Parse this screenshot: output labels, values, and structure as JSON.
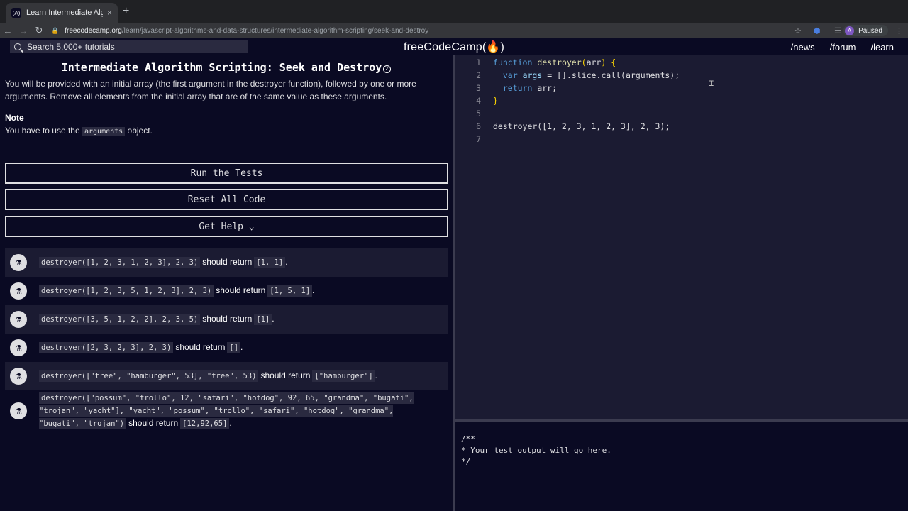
{
  "browser": {
    "tab_title": "Learn Intermediate Algorithm S",
    "tab_close": "×",
    "new_tab": "+",
    "url_host": "freecodecamp.org",
    "url_path": "/learn/javascript-algorithms-and-data-structures/intermediate-algorithm-scripting/seek-and-destroy",
    "profile_initial": "A",
    "profile_status": "Paused"
  },
  "navbar": {
    "search_placeholder": "Search 5,000+ tutorials",
    "logo": "freeCodeCamp(🔥)",
    "links": [
      "/news",
      "/forum",
      "/learn"
    ]
  },
  "challenge": {
    "title": "Intermediate Algorithm Scripting: Seek and Destroy",
    "description": "You will be provided with an initial array (the first argument in the destroyer function), followed by one or more arguments. Remove all elements from the initial array that are of the same value as these arguments.",
    "note_heading": "Note",
    "note_pre": "You have to use the",
    "note_code": "arguments",
    "note_post": "object."
  },
  "buttons": {
    "run": "Run the Tests",
    "reset": "Reset All Code",
    "help": "Get Help ⌄"
  },
  "tests": [
    {
      "call": "destroyer([1, 2, 3, 1, 2, 3], 2, 3)",
      "word": "should return",
      "result": "[1, 1]",
      "end": "."
    },
    {
      "call": "destroyer([1, 2, 3, 5, 1, 2, 3], 2, 3)",
      "word": "should return",
      "result": "[1, 5, 1]",
      "end": "."
    },
    {
      "call": "destroyer([3, 5, 1, 2, 2], 2, 3, 5)",
      "word": "should return",
      "result": "[1]",
      "end": "."
    },
    {
      "call": "destroyer([2, 3, 2, 3], 2, 3)",
      "word": "should return",
      "result": "[]",
      "end": "."
    },
    {
      "call": "destroyer([\"tree\", \"hamburger\", 53], \"tree\", 53)",
      "word": "should return",
      "result": "[\"hamburger\"]",
      "end": "."
    },
    {
      "call": "destroyer([\"possum\", \"trollo\", 12, \"safari\", \"hotdog\", 92, 65, \"grandma\", \"bugati\", \"trojan\", \"yacht\"], \"yacht\", \"possum\", \"trollo\", \"safari\", \"hotdog\", \"grandma\", \"bugati\", \"trojan\")",
      "word": "should return",
      "result": "[12,92,65]",
      "end": "."
    }
  ],
  "editor": {
    "line_numbers": [
      "1",
      "2",
      "3",
      "4",
      "5",
      "6",
      "7"
    ],
    "l1_kw": "function",
    "l1_fn": "destroyer",
    "l1_p": "arr",
    "l2_kw": "var",
    "l2_v": "args",
    "l2_rest": " = [].slice.call(arguments);",
    "l3_kw": "return",
    "l3_rest": " arr;",
    "l6": "destroyer([1, 2, 3, 1, 2, 3], 2, 3);"
  },
  "output": {
    "text": "/**\n* Your test output will go here.\n*/"
  }
}
